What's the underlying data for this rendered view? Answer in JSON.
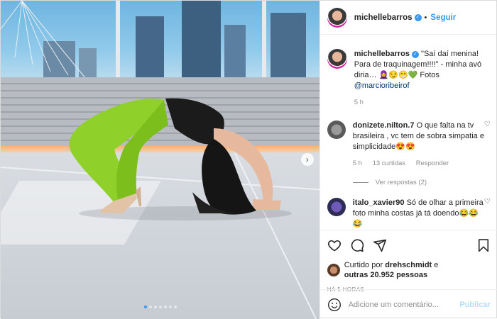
{
  "post": {
    "username": "michellebarros",
    "follow_label": "Seguir",
    "caption_user": "michellebarros",
    "caption_text": "\"Saí daí menina! Para de traquinagem!!!!\" - minha avó diria… 🧕😏😁💚 Fotos",
    "caption_mention": "@marcioribeirof",
    "caption_time": "5 h"
  },
  "comments": [
    {
      "username": "donizete.nilton.7",
      "text": "O que falta na tv brasileira , vc tem de sobra simpatia e simplicidade😍😍",
      "time": "5 h",
      "likes": "13 curtidas",
      "reply_label": "Responder",
      "view_replies": "Ver respostas (2)"
    },
    {
      "username": "italo_xavier90",
      "text": "Só de olhar a primeira foto minha costas já tá doendo😂😂😂"
    }
  ],
  "likes": {
    "prefix": "Curtido por",
    "user": "drehschmidt",
    "middle": "e",
    "others": "outras 20.952 pessoas"
  },
  "timestamp": "HÁ 5 HORAS",
  "comment_input": {
    "placeholder": "Adicione um comentário...",
    "publish_label": "Publicar"
  },
  "carousel": {
    "count": 7,
    "current": 1
  },
  "colors": {
    "accent": "#3897f0",
    "link": "#00376b",
    "muted": "#8e8e8e",
    "publish_disabled": "#b2dffc"
  },
  "icons": [
    "heart-icon",
    "comment-icon",
    "share-icon",
    "bookmark-icon",
    "emoji-icon",
    "verified-icon",
    "chevron-right-icon"
  ]
}
